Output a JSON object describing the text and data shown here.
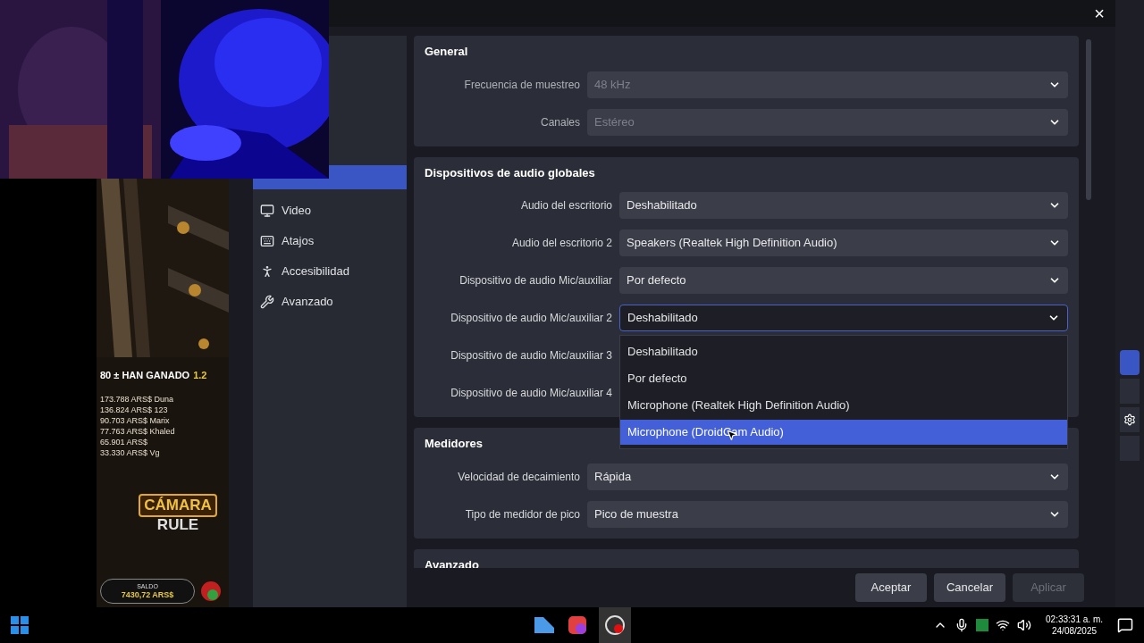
{
  "game_panel": {
    "winners_title": "80 ± HAN GANADO",
    "winners_total": "1.2",
    "winners": [
      "173.788 ARS$ Duna",
      "136.824 ARS$ 123",
      "90.703 ARS$ Marix",
      "77.763 ARS$ Khaled",
      "65.901 ARS$",
      "33.330 ARS$ Vg"
    ],
    "logo": [
      "CÁMARA",
      "RULE"
    ],
    "balance_label": "SALDO",
    "balance": "7430,72 ARS$"
  },
  "settings": {
    "close": "×",
    "sidebar": [
      {
        "label": "Video",
        "selected": false
      },
      {
        "label": "Atajos",
        "selected": false
      },
      {
        "label": "Accesibilidad",
        "selected": false
      },
      {
        "label": "Avanzado",
        "selected": false
      }
    ],
    "groups": [
      {
        "title": "General",
        "rows": [
          {
            "label": "Frecuencia de muestreo",
            "value": "48 kHz",
            "disabled": true
          },
          {
            "label": "Canales",
            "value": "Estéreo",
            "disabled": true
          }
        ]
      },
      {
        "title": "Dispositivos de audio globales",
        "rows": [
          {
            "label": "Audio del escritorio",
            "value": "Deshabilitado",
            "disabled": false
          },
          {
            "label": "Audio del escritorio 2",
            "value": "Speakers (Realtek High Definition Audio)",
            "disabled": false
          },
          {
            "label": "Dispositivo de audio Mic/auxiliar",
            "value": "Por defecto",
            "disabled": false
          },
          {
            "label": "Dispositivo de audio Mic/auxiliar 2",
            "value": "Deshabilitado",
            "disabled": false,
            "open": true
          },
          {
            "label": "Dispositivo de audio Mic/auxiliar 3",
            "disabled": false
          },
          {
            "label": "Dispositivo de audio Mic/auxiliar 4",
            "disabled": false
          }
        ]
      },
      {
        "title": "Medidores",
        "rows": [
          {
            "label": "Velocidad de decaimiento",
            "value": "Rápida",
            "disabled": false
          },
          {
            "label": "Tipo de medidor de pico",
            "value": "Pico de muestra",
            "disabled": false
          }
        ]
      },
      {
        "title": "Avanzado"
      }
    ],
    "dropdown_options": [
      {
        "label": "Deshabilitado",
        "selected": false
      },
      {
        "label": "Por defecto",
        "selected": false
      },
      {
        "label": "Microphone (Realtek High Definition Audio)",
        "selected": false
      },
      {
        "label": "Microphone (DroidCam Audio)",
        "selected": true
      }
    ],
    "buttons": [
      {
        "label": "Aceptar",
        "disabled": false
      },
      {
        "label": "Cancelar",
        "disabled": false
      },
      {
        "label": "Aplicar",
        "disabled": true
      }
    ]
  },
  "taskbar": {
    "time": "02:33:31 a. m.",
    "date": "24/08/2025"
  }
}
